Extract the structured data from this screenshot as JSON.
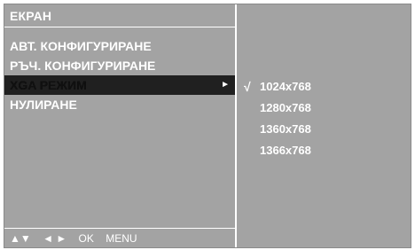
{
  "osd": {
    "title": "ЕКРАН",
    "menu": [
      {
        "label": "АВТ. КОНФИГУРИРАНЕ",
        "selected": false
      },
      {
        "label": "РЪЧ. КОНФИГУРИРАНЕ",
        "selected": false
      },
      {
        "label": "XGA РЕЖИМ",
        "selected": true,
        "submenu_arrow": "►"
      },
      {
        "label": "НУЛИРАНЕ",
        "selected": false
      }
    ],
    "footer": {
      "updown": "▲▼",
      "leftright": "◄ ►",
      "ok": "OK",
      "menu": "MENU"
    },
    "submenu": {
      "check_mark": "√",
      "options": [
        "1024x768",
        "1280x768",
        "1360x768",
        "1366x768"
      ],
      "selected_index": 0
    }
  },
  "colors": {
    "panel_bg": "#a3a3a3",
    "text": "#ffffff",
    "highlight_bg": "#202020"
  }
}
